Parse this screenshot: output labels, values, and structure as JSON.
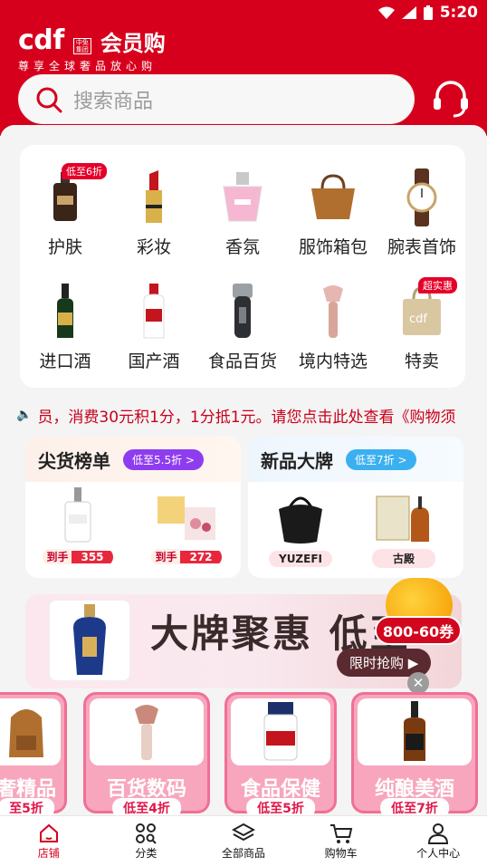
{
  "status_bar": {
    "time": "5:20"
  },
  "header": {
    "logo_text": "cdf",
    "logo_badge": "中免集团",
    "app_name": "会员购",
    "slogan": "尊享全球奢品放心购"
  },
  "search": {
    "placeholder": "搜索商品"
  },
  "categories": [
    {
      "label": "护肤",
      "tag": "低至6折"
    },
    {
      "label": "彩妆"
    },
    {
      "label": "香氛"
    },
    {
      "label": "服饰箱包"
    },
    {
      "label": "腕表首饰"
    },
    {
      "label": "进口酒"
    },
    {
      "label": "国产酒"
    },
    {
      "label": "食品百货"
    },
    {
      "label": "境内特选"
    },
    {
      "label": "特卖",
      "tag": "超实惠"
    }
  ],
  "notice": {
    "text": "员，消费30元积1分，1分抵1元。请您点击此处查看《购物须"
  },
  "hot_list": {
    "title": "尖货榜单",
    "pill": "低至5.5折 >",
    "pill_color": "#8f3cf0",
    "products": [
      {
        "label": "到手",
        "price": "355"
      },
      {
        "label": "到手",
        "price": "272"
      }
    ]
  },
  "new_brands": {
    "title": "新品大牌",
    "pill": "低至7折 >",
    "pill_color": "#3bb0f0",
    "brands": [
      "YUZEFI",
      "古殿"
    ]
  },
  "banner": {
    "text": "大牌聚惠 低至",
    "cta": "限时抢购 ▶"
  },
  "coupon": {
    "label": "800-60券"
  },
  "promo_tiles": [
    {
      "name": "奢精品",
      "discount": "至5折"
    },
    {
      "name": "百货数码",
      "discount": "低至4折"
    },
    {
      "name": "食品保健",
      "discount": "低至5折"
    },
    {
      "name": "纯酿美酒",
      "discount": "低至7折"
    }
  ],
  "bottom_nav": [
    {
      "label": "店铺",
      "active": true
    },
    {
      "label": "分类"
    },
    {
      "label": "全部商品"
    },
    {
      "label": "购物车"
    },
    {
      "label": "个人中心"
    }
  ]
}
